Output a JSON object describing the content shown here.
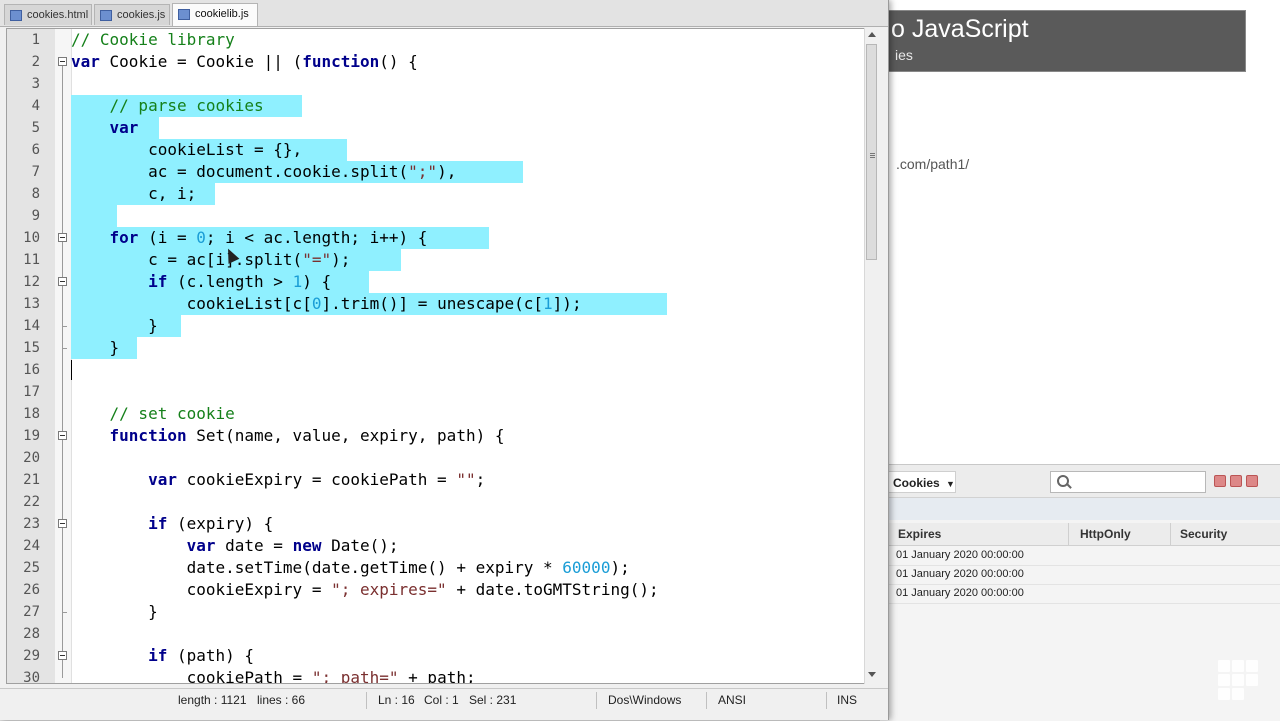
{
  "tabs": [
    {
      "label": "cookies.html",
      "active": false
    },
    {
      "label": "cookies.js",
      "active": false
    },
    {
      "label": "cookielib.js",
      "active": true
    }
  ],
  "code_lines": [
    {
      "n": "1"
    },
    {
      "n": "2"
    },
    {
      "n": "3"
    },
    {
      "n": "4"
    },
    {
      "n": "5"
    },
    {
      "n": "6"
    },
    {
      "n": "7"
    },
    {
      "n": "8"
    },
    {
      "n": "9"
    },
    {
      "n": "10"
    },
    {
      "n": "11"
    },
    {
      "n": "12"
    },
    {
      "n": "13"
    },
    {
      "n": "14"
    },
    {
      "n": "15"
    },
    {
      "n": "16"
    },
    {
      "n": "17"
    },
    {
      "n": "18"
    },
    {
      "n": "19"
    },
    {
      "n": "20"
    },
    {
      "n": "21"
    },
    {
      "n": "22"
    },
    {
      "n": "23"
    },
    {
      "n": "24"
    },
    {
      "n": "25"
    },
    {
      "n": "26"
    },
    {
      "n": "27"
    },
    {
      "n": "28"
    },
    {
      "n": "29"
    },
    {
      "n": "30"
    }
  ],
  "code": {
    "l1": "// Cookie library",
    "l2a": "var",
    "l2b": " Cookie = Cookie || (",
    "l2c": "function",
    "l2d": "() {",
    "l4": "    // parse cookies",
    "l5": "    var",
    "l6": "        cookieList = {},",
    "l7a": "        ac = document.cookie.split(",
    "l7b": "\";\"",
    "l7c": "),",
    "l8": "        c, i;",
    "l10a": "    for",
    "l10b": " (i = ",
    "l10c": "0",
    "l10d": "; i < ac.length; i++) {",
    "l11a": "        c = ac[i].split(",
    "l11b": "\"=\"",
    "l11c": ");",
    "l12a": "        if",
    "l12b": " (c.length > ",
    "l12c": "1",
    "l12d": ") {",
    "l13a": "            cookieList[c[",
    "l13b": "0",
    "l13c": "].trim()] = unescape(c[",
    "l13d": "1",
    "l13e": "]);",
    "l14": "        }",
    "l15": "    }",
    "l18": "    // set cookie",
    "l19a": "    function",
    "l19b": " Set(name, value, expiry, path) {",
    "l21a": "        var",
    "l21b": " cookieExpiry = cookiePath = ",
    "l21c": "\"\"",
    "l21d": ";",
    "l23a": "        if",
    "l23b": " (expiry) {",
    "l24a": "            var",
    "l24b": " date = ",
    "l24c": "new",
    "l24d": " Date();",
    "l25a": "            date.setTime(date.getTime() + expiry * ",
    "l25b": "60000",
    "l25c": ");",
    "l26a": "            cookieExpiry = ",
    "l26b": "\"; expires=\"",
    "l26c": " + date.toGMTString();",
    "l27": "        }",
    "l29a": "        if",
    "l29b": " (path) {",
    "l30a": "            cookiePath = ",
    "l30b": "\"; path=\"",
    "l30c": " + path;"
  },
  "status": {
    "length": "length : 1121",
    "lines": "lines : 66",
    "ln": "Ln : 16",
    "col": "Col : 1",
    "sel": "Sel : 231",
    "eol": "Dos\\Windows",
    "encoding": "ANSI",
    "mode": "INS"
  },
  "browser": {
    "banner_title": "o JavaScript",
    "banner_sub": "ies",
    "url_fragment": ".com/path1/",
    "devtools_dropdown": "Cookies",
    "columns": [
      "Expires",
      "HttpOnly",
      "Security"
    ],
    "rows": [
      {
        "expires": "01 January 2020 00:00:00"
      },
      {
        "expires": "01 January 2020 00:00:00"
      },
      {
        "expires": "01 January 2020 00:00:00"
      }
    ]
  },
  "colors": {
    "selection": "#8ff0ff",
    "comment": "#15801a",
    "keyword": "#00008b",
    "number": "#1a9dd6",
    "string": "#7a2f2f"
  }
}
